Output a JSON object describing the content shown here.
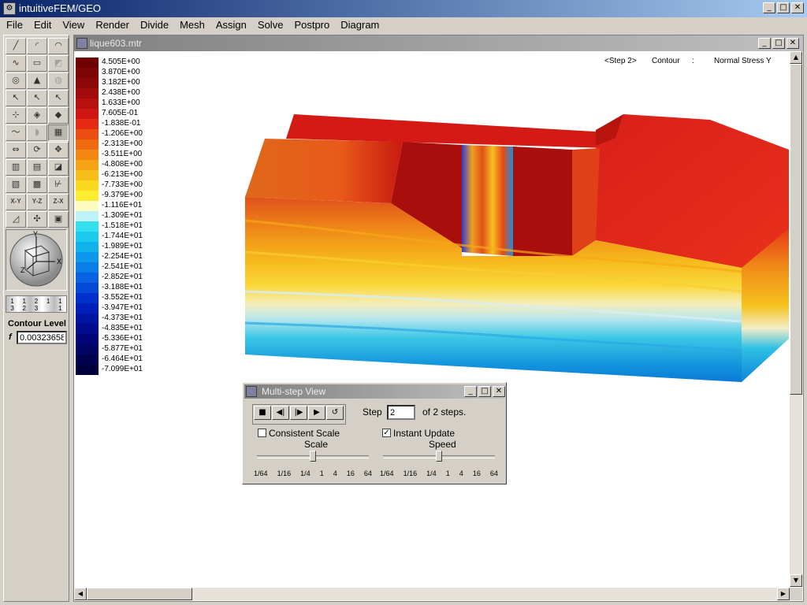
{
  "app": {
    "title": "intuitiveFEM/GEO"
  },
  "menu": [
    "File",
    "Edit",
    "View",
    "Render",
    "Divide",
    "Mesh",
    "Assign",
    "Solve",
    "Postpro",
    "Diagram"
  ],
  "toolbox": {
    "tools": [
      {
        "name": "line-tool-icon",
        "glyph": "╱"
      },
      {
        "name": "arc-tool-icon",
        "glyph": "◜"
      },
      {
        "name": "circle-arc-tool-icon",
        "glyph": "◠"
      },
      {
        "name": "spline-tool-icon",
        "glyph": "∿"
      },
      {
        "name": "rectangle-tool-icon",
        "glyph": "▭"
      },
      {
        "name": "surface-tool-icon",
        "glyph": "◩"
      },
      {
        "name": "sphere-tool-icon",
        "glyph": "◎"
      },
      {
        "name": "cone-tool-icon",
        "glyph": "▲"
      },
      {
        "name": "torus-tool-icon",
        "glyph": "◍"
      },
      {
        "name": "select-tool-icon",
        "glyph": "↖"
      },
      {
        "name": "select-add-tool-icon",
        "glyph": "↖"
      },
      {
        "name": "select-edge-tool-icon",
        "glyph": "↖"
      },
      {
        "name": "pick-node-tool-icon",
        "glyph": "⊹"
      },
      {
        "name": "pick-face-tool-icon",
        "glyph": "◈"
      },
      {
        "name": "pick-solid-tool-icon",
        "glyph": "◆"
      },
      {
        "name": "curve-tool-icon",
        "glyph": "〜"
      },
      {
        "name": "sweep-tool-icon",
        "glyph": "◗"
      },
      {
        "name": "contour-tool-icon",
        "glyph": "▦"
      },
      {
        "name": "move-tool-icon",
        "glyph": "⇔"
      },
      {
        "name": "rotate-tool-icon",
        "glyph": "⟳"
      },
      {
        "name": "pan-tool-icon",
        "glyph": "✥"
      },
      {
        "name": "box-view-tool-icon",
        "glyph": "▥"
      },
      {
        "name": "wire-box-tool-icon",
        "glyph": "▤"
      },
      {
        "name": "cube-view-tool-icon",
        "glyph": "◪"
      },
      {
        "name": "layer-tool-icon",
        "glyph": "▧"
      },
      {
        "name": "mesh-tool-icon",
        "glyph": "▩"
      },
      {
        "name": "graph-tool-icon",
        "glyph": "⊬"
      },
      {
        "name": "view-xy-icon",
        "glyph": "X-Y"
      },
      {
        "name": "view-yz-icon",
        "glyph": "Y-Z"
      },
      {
        "name": "view-zx-icon",
        "glyph": "Z-X"
      },
      {
        "name": "zoom-fit-tool-icon",
        "glyph": "◿"
      },
      {
        "name": "zoom-pan-tool-icon",
        "glyph": "✣"
      },
      {
        "name": "point-tool-icon",
        "glyph": "▣"
      }
    ],
    "orbit_axes": {
      "x": "X",
      "y": "Y",
      "z": "Z"
    },
    "ruler_marks": [
      "1\n3",
      "1\n2",
      "2\n3",
      "1",
      "1\n1"
    ],
    "contour_label": "Contour Level",
    "f_label": "f",
    "f_value": "0.00323658"
  },
  "document": {
    "title": "lique603.mtr",
    "step_label": "<Step 2>",
    "mode_label": "Contour",
    "separator": ":",
    "variable_label": "Normal Stress Y"
  },
  "legend": [
    {
      "value": "4.505E+00",
      "color": "#6e0000"
    },
    {
      "value": "3.870E+00",
      "color": "#7e0505"
    },
    {
      "value": "3.182E+00",
      "color": "#8c0808"
    },
    {
      "value": "2.438E+00",
      "color": "#a10b0b"
    },
    {
      "value": "1.633E+00",
      "color": "#b80f0f"
    },
    {
      "value": "7.605E-01",
      "color": "#cf1414"
    },
    {
      "value": "-1.838E-01",
      "color": "#e52a12"
    },
    {
      "value": "-1.206E+00",
      "color": "#ec4d10"
    },
    {
      "value": "-2.313E+00",
      "color": "#f06a10"
    },
    {
      "value": "-3.511E+00",
      "color": "#f48612"
    },
    {
      "value": "-4.808E+00",
      "color": "#f5a214"
    },
    {
      "value": "-6.213E+00",
      "color": "#f7bd18"
    },
    {
      "value": "-7.733E+00",
      "color": "#f9d81e"
    },
    {
      "value": "-9.379E+00",
      "color": "#fbee30"
    },
    {
      "value": "-1.116E+01",
      "color": "#fdfcc0"
    },
    {
      "value": "-1.309E+01",
      "color": "#bdf3f8"
    },
    {
      "value": "-1.518E+01",
      "color": "#34e0ee"
    },
    {
      "value": "-1.744E+01",
      "color": "#1ccbec"
    },
    {
      "value": "-1.989E+01",
      "color": "#10b2ec"
    },
    {
      "value": "-2.254E+01",
      "color": "#0d98ec"
    },
    {
      "value": "-2.541E+01",
      "color": "#0a7de9"
    },
    {
      "value": "-2.852E+01",
      "color": "#0862e2"
    },
    {
      "value": "-3.188E+01",
      "color": "#0448d8"
    },
    {
      "value": "-3.552E+01",
      "color": "#0030cc"
    },
    {
      "value": "-3.947E+01",
      "color": "#001fb8"
    },
    {
      "value": "-4.373E+01",
      "color": "#0014a2"
    },
    {
      "value": "-4.835E+01",
      "color": "#000c8c"
    },
    {
      "value": "-5.336E+01",
      "color": "#000677"
    },
    {
      "value": "-5.877E+01",
      "color": "#000462"
    },
    {
      "value": "-6.464E+01",
      "color": "#00024d"
    },
    {
      "value": "-7.099E+01",
      "color": "#00003c"
    }
  ],
  "dialog": {
    "title": "Multi-step View",
    "transport": [
      {
        "name": "stop-icon",
        "glyph": "■"
      },
      {
        "name": "step-back-icon",
        "glyph": "◀|"
      },
      {
        "name": "step-forward-icon",
        "glyph": "|▶"
      },
      {
        "name": "play-icon",
        "glyph": "▶"
      },
      {
        "name": "loop-icon",
        "glyph": "↺"
      }
    ],
    "step_label": "Step",
    "step_value": "2",
    "step_total": "of 2 steps.",
    "consistent_scale": {
      "label": "Consistent Scale",
      "checked": false
    },
    "instant_update": {
      "label": "Instant Update",
      "checked": true
    },
    "scale_label": "Scale",
    "speed_label": "Speed",
    "ticks": [
      "1/64",
      "1/16",
      "1/4",
      "1",
      "4",
      "16",
      "64"
    ],
    "scale_position": 0.5,
    "speed_position": 0.5
  }
}
